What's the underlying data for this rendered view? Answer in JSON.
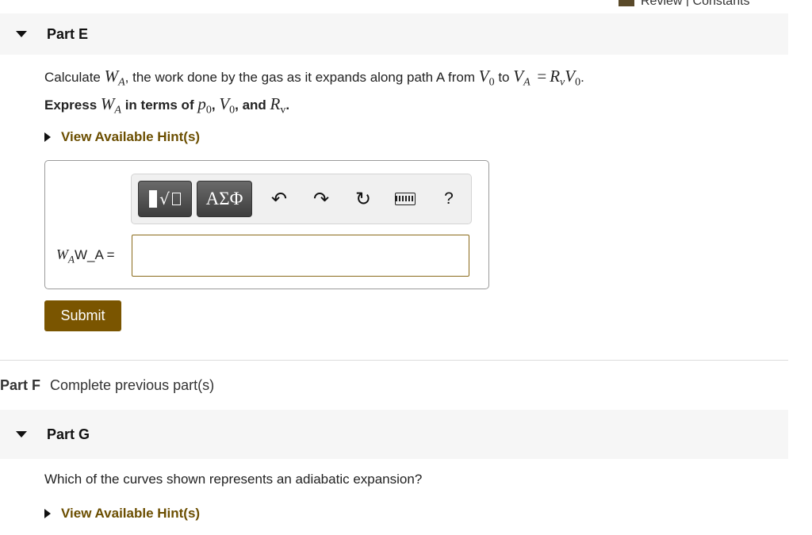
{
  "top_link": {
    "label": "Review | Constants"
  },
  "part_e": {
    "title": "Part E",
    "question_pre": "Calculate",
    "wa_sym": "W",
    "wa_sub": "A",
    "question_mid": ", the work done by the gas as it expands along path A from",
    "v0_sym": "V",
    "v0_sub": "0",
    "to_word": "to",
    "va_sym": "V",
    "va_sub": "A",
    "equals": "=",
    "rv_sym": "R",
    "rv_sub": "v",
    "v0b_sym": "V",
    "v0b_sub": "0",
    "period": ".",
    "express_pre": "Express",
    "express_mid": "in terms of",
    "p0_sym": "p",
    "p0_sub": "0",
    "comma1": ",",
    "comma2": ", and",
    "rvb_sub": "v",
    "express_end": ".",
    "hint_label": "View Available Hint(s)",
    "toolbar": {
      "templates_icon": "templates-icon",
      "greek_label": "ΑΣΦ",
      "undo": "↶",
      "redo": "↷",
      "reset": "↻",
      "help": "?"
    },
    "answer_label_sym": "W",
    "answer_label_sub": "A",
    "answer_label_text": "W_A =",
    "answer_value": "",
    "submit_label": "Submit"
  },
  "part_f": {
    "title": "Part F",
    "status": "Complete previous part(s)"
  },
  "part_g": {
    "title": "Part G",
    "question": "Which of the curves shown represents an adiabatic expansion?",
    "hint_label": "View Available Hint(s)"
  },
  "colors": {
    "accent": "#7a5500",
    "hint": "#6b4e00",
    "header_bg": "#f6f6f6"
  }
}
